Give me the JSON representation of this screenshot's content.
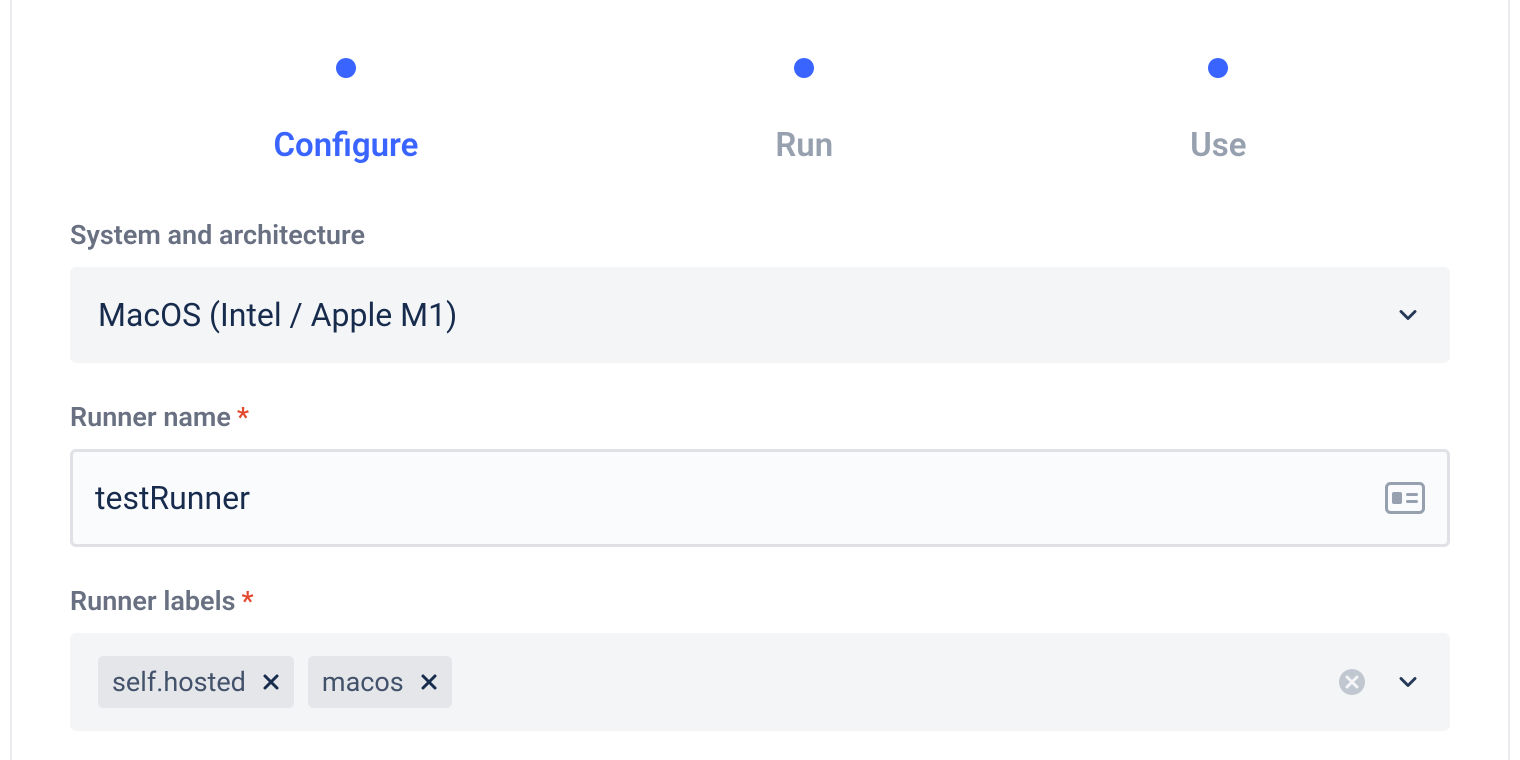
{
  "stepper": {
    "steps": [
      {
        "label": "Configure",
        "active": true
      },
      {
        "label": "Run",
        "active": false
      },
      {
        "label": "Use",
        "active": false
      }
    ]
  },
  "fields": {
    "system": {
      "label": "System and architecture",
      "value": "MacOS (Intel / Apple M1)"
    },
    "runner_name": {
      "label": "Runner name",
      "value": "testRunner"
    },
    "runner_labels": {
      "label": "Runner labels",
      "tags": [
        {
          "text": "self.hosted"
        },
        {
          "text": "macos"
        }
      ]
    }
  }
}
